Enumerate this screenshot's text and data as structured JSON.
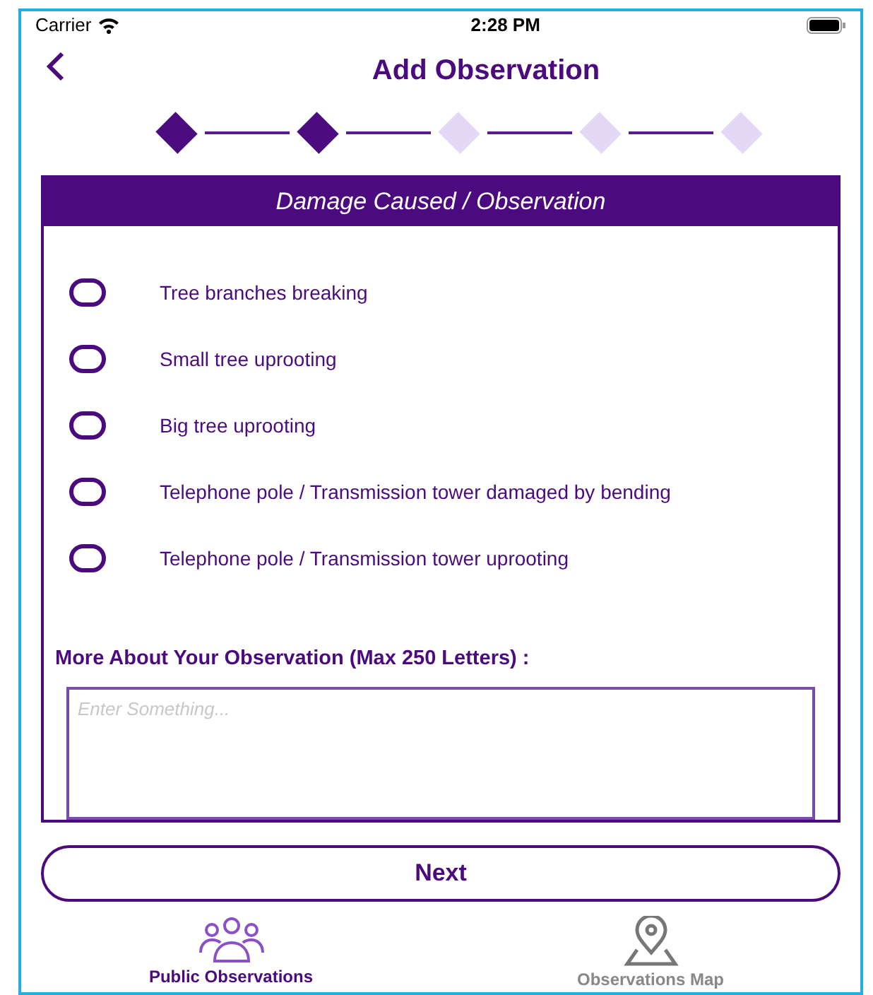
{
  "status_bar": {
    "carrier": "Carrier",
    "time": "2:28 PM"
  },
  "header": {
    "title": "Add Observation"
  },
  "steps": [
    {
      "done": true
    },
    {
      "done": true
    },
    {
      "done": false
    },
    {
      "done": false
    },
    {
      "done": false
    }
  ],
  "card": {
    "title": "Damage Caused / Observation",
    "options": [
      {
        "label": "Tree branches breaking",
        "selected": false
      },
      {
        "label": "Small tree uprooting",
        "selected": false
      },
      {
        "label": "Big tree uprooting",
        "selected": false
      },
      {
        "label": "Telephone pole / Transmission tower damaged by bending",
        "selected": false
      },
      {
        "label": "Telephone pole / Transmission tower uprooting",
        "selected": false
      }
    ],
    "more_label": "More About Your Observation (Max 250 Letters) :",
    "more_field": {
      "placeholder": "Enter Something..."
    }
  },
  "next_button": "Next",
  "tabs": [
    {
      "label": "Public Observations",
      "kind": "people",
      "selected": true
    },
    {
      "label": "Observations Map",
      "kind": "map",
      "selected": false
    }
  ]
}
